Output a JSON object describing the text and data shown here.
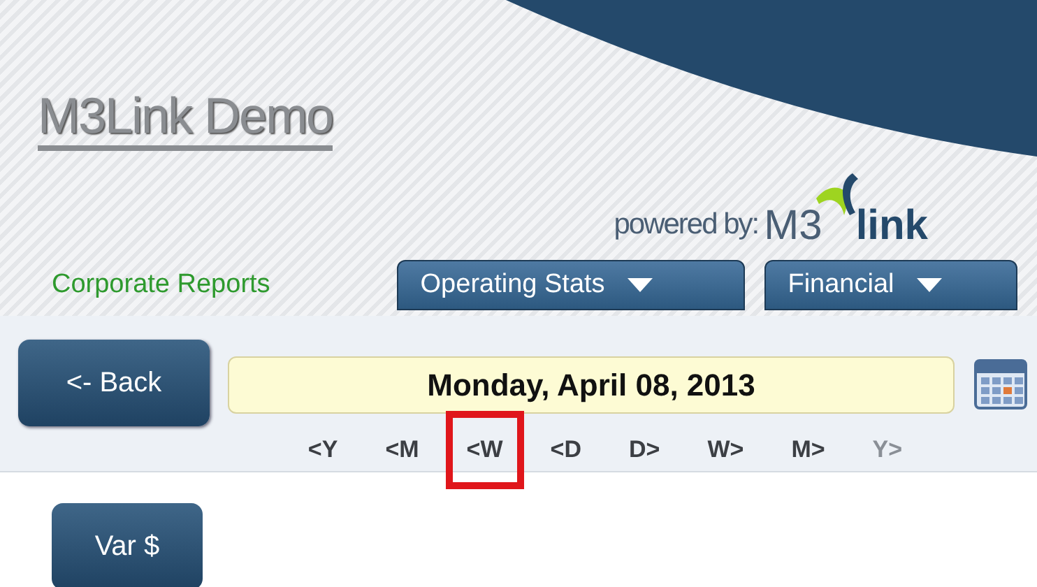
{
  "header": {
    "title": "M3Link Demo",
    "powered_by": "powered by:",
    "brand_left": "M3",
    "brand_right": "link"
  },
  "menu": {
    "home": "Corporate Reports",
    "tabs": [
      {
        "label": "Operating Stats",
        "selected": false
      },
      {
        "label": "Financial",
        "selected": false
      }
    ]
  },
  "back_button": "<- Back",
  "date": "Monday, April 08, 2013",
  "date_steps": [
    {
      "label": "<Y",
      "disabled": false,
      "highlighted": false
    },
    {
      "label": "<M",
      "disabled": false,
      "highlighted": false
    },
    {
      "label": "<W",
      "disabled": false,
      "highlighted": true
    },
    {
      "label": "<D",
      "disabled": false,
      "highlighted": false
    },
    {
      "label": "D>",
      "disabled": false,
      "highlighted": false
    },
    {
      "label": "W>",
      "disabled": false,
      "highlighted": false
    },
    {
      "label": "M>",
      "disabled": false,
      "highlighted": false
    },
    {
      "label": "Y>",
      "disabled": true,
      "highlighted": false
    }
  ],
  "var_button": "Var $"
}
